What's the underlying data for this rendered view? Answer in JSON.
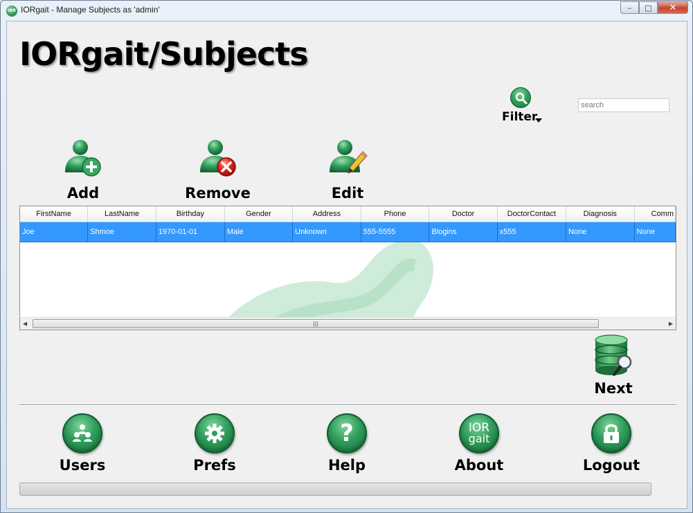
{
  "window": {
    "title": "IORgait - Manage Subjects as 'admin'",
    "app_icon_text": "IOR",
    "minimize": "–",
    "maximize": "□",
    "close": "✕"
  },
  "page": {
    "title": "IORgait/Subjects"
  },
  "filter": {
    "label": "Filter",
    "icon": "magnifier-icon"
  },
  "search": {
    "placeholder": "search",
    "value": ""
  },
  "actions": {
    "add": {
      "label": "Add",
      "icon": "add-user-icon"
    },
    "remove": {
      "label": "Remove",
      "icon": "remove-user-icon"
    },
    "edit": {
      "label": "Edit",
      "icon": "edit-user-icon"
    }
  },
  "table": {
    "columns": [
      "FirstName",
      "LastName",
      "Birthday",
      "Gender",
      "Address",
      "Phone",
      "Doctor",
      "DoctorContact",
      "Diagnosis",
      "Comm"
    ],
    "rows": [
      [
        "Joe",
        "Shmoe",
        "1970-01-01",
        "Male",
        "Unknown",
        "555-5555",
        "Blogins",
        "x555",
        "None",
        "None"
      ]
    ],
    "selected_row": 0,
    "selection_color": "#3399ff",
    "scroll_left": "◀",
    "scroll_right": "▶",
    "scroll_grip": "|||"
  },
  "next": {
    "label": "Next",
    "icon": "database-search-icon"
  },
  "bottom": {
    "users": {
      "label": "Users",
      "icon": "users-icon"
    },
    "prefs": {
      "label": "Prefs",
      "icon": "gear-icon"
    },
    "help": {
      "label": "Help",
      "icon": "question-icon",
      "glyph": "?"
    },
    "about": {
      "label": "About",
      "icon": "ior-gait-logo-icon",
      "line1": "IOR",
      "line2": "gait"
    },
    "logout": {
      "label": "Logout",
      "icon": "lock-icon"
    }
  },
  "colors": {
    "accent_green": "#2f9d5b",
    "dark_green": "#15703a",
    "selection": "#3399ff"
  }
}
